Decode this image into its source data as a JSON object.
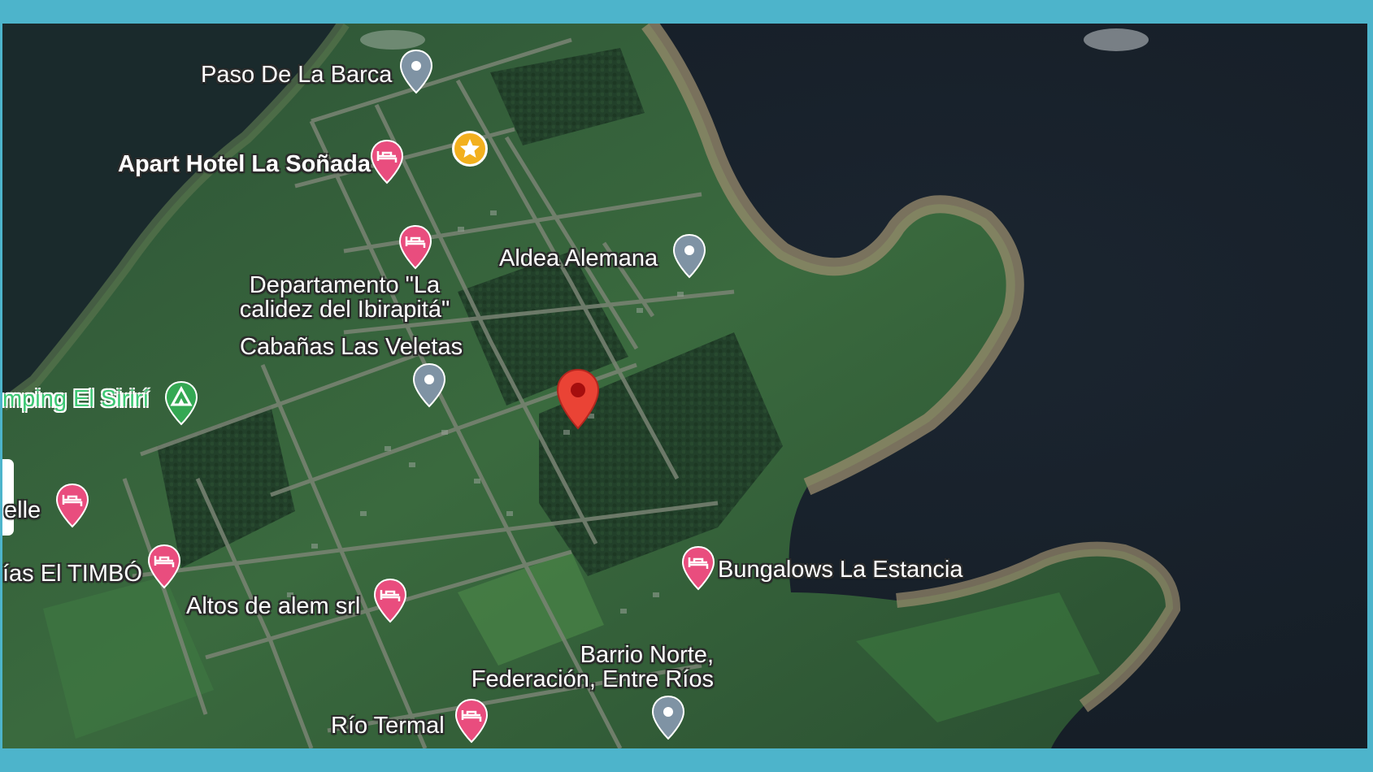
{
  "colors": {
    "frame": "#4db4cb",
    "water": "#18222c",
    "land": "#2f5a36",
    "road": "#6e7a68",
    "lodging_pin": "#e94d7e",
    "place_pin": "#7f93a4",
    "camp_pin": "#34a853",
    "star_pin": "#f2b01e",
    "selected_pin": "#ea4335"
  },
  "map": {
    "labels": {
      "paso_barca": "Paso De La Barca",
      "apart_hotel": "Apart Hotel La Soñada",
      "departamento": "Departamento \"La calidez del Ibirapitá\"",
      "aldea": "Aldea Alemana",
      "cabanas": "Cabañas Las Veletas",
      "camping": "mping El Sirirí",
      "elle": "elle",
      "timbo": "ías El TIMBÓ",
      "altos": "Altos de alem srl",
      "bungalows": "Bungalows La Estancia",
      "barrio": "Barrio Norte, Federación, Entre Ríos",
      "rio_termal": "Río Termal"
    },
    "pins": [
      {
        "id": "paso-barca",
        "kind": "place",
        "icon": "location-pin-icon"
      },
      {
        "id": "starred",
        "kind": "star",
        "icon": "star-pin-icon"
      },
      {
        "id": "apart-hotel",
        "kind": "lodging",
        "icon": "bed-pin-icon"
      },
      {
        "id": "departamento",
        "kind": "lodging",
        "icon": "bed-pin-icon"
      },
      {
        "id": "aldea",
        "kind": "place",
        "icon": "location-pin-icon"
      },
      {
        "id": "cabanas",
        "kind": "place",
        "icon": "location-pin-icon"
      },
      {
        "id": "selected",
        "kind": "selected",
        "icon": "red-marker-icon"
      },
      {
        "id": "camping",
        "kind": "camp",
        "icon": "tent-pin-icon"
      },
      {
        "id": "elle",
        "kind": "lodging",
        "icon": "bed-pin-icon"
      },
      {
        "id": "timbo",
        "kind": "lodging",
        "icon": "bed-pin-icon"
      },
      {
        "id": "altos",
        "kind": "lodging",
        "icon": "bed-pin-icon"
      },
      {
        "id": "bungalows",
        "kind": "lodging",
        "icon": "bed-pin-icon"
      },
      {
        "id": "barrio",
        "kind": "place",
        "icon": "location-pin-icon"
      },
      {
        "id": "rio-termal",
        "kind": "lodging",
        "icon": "bed-pin-icon"
      }
    ]
  }
}
